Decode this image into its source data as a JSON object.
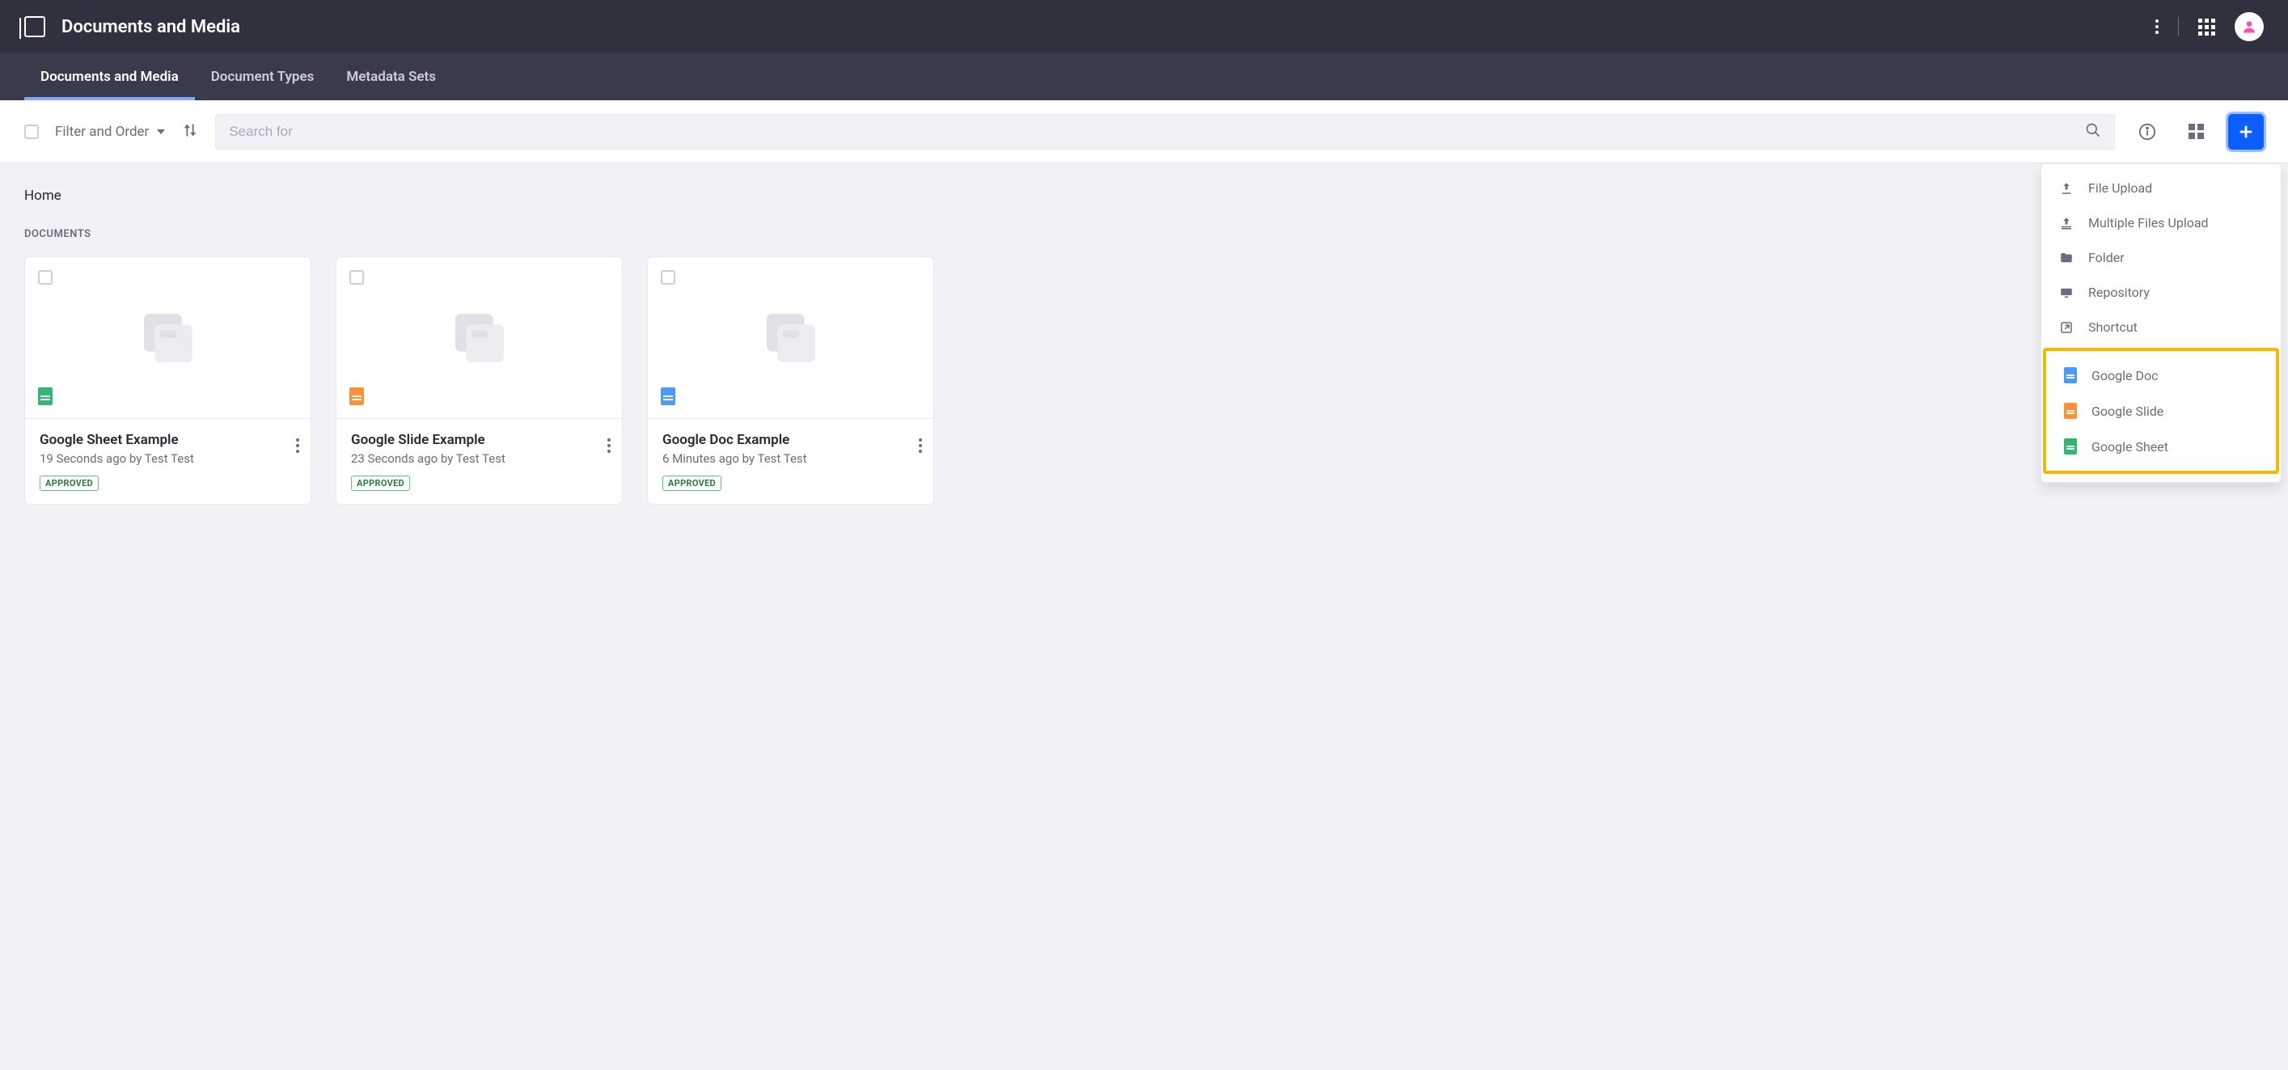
{
  "header": {
    "title": "Documents and Media"
  },
  "tabs": [
    {
      "label": "Documents and Media",
      "active": true
    },
    {
      "label": "Document Types",
      "active": false
    },
    {
      "label": "Metadata Sets",
      "active": false
    }
  ],
  "toolbar": {
    "filter_label": "Filter and Order",
    "search_placeholder": "Search for"
  },
  "breadcrumb": "Home",
  "section_title": "DOCUMENTS",
  "cards": [
    {
      "title": "Google Sheet Example",
      "meta": "19 Seconds ago by Test Test",
      "status": "APPROVED",
      "type": "sheet"
    },
    {
      "title": "Google Slide Example",
      "meta": "23 Seconds ago by Test Test",
      "status": "APPROVED",
      "type": "slide"
    },
    {
      "title": "Google Doc Example",
      "meta": "6 Minutes ago by Test Test",
      "status": "APPROVED",
      "type": "doc"
    }
  ],
  "dropdown": {
    "group1": [
      {
        "label": "File Upload",
        "icon": "upload"
      },
      {
        "label": "Multiple Files Upload",
        "icon": "upload-multi"
      },
      {
        "label": "Folder",
        "icon": "folder"
      },
      {
        "label": "Repository",
        "icon": "repository"
      },
      {
        "label": "Shortcut",
        "icon": "shortcut"
      }
    ],
    "group2": [
      {
        "label": "Google Doc",
        "icon": "blue"
      },
      {
        "label": "Google Slide",
        "icon": "orange"
      },
      {
        "label": "Google Sheet",
        "icon": "green"
      }
    ]
  },
  "colors": {
    "primary": "#0b5fff",
    "highlight": "#f5b800"
  }
}
